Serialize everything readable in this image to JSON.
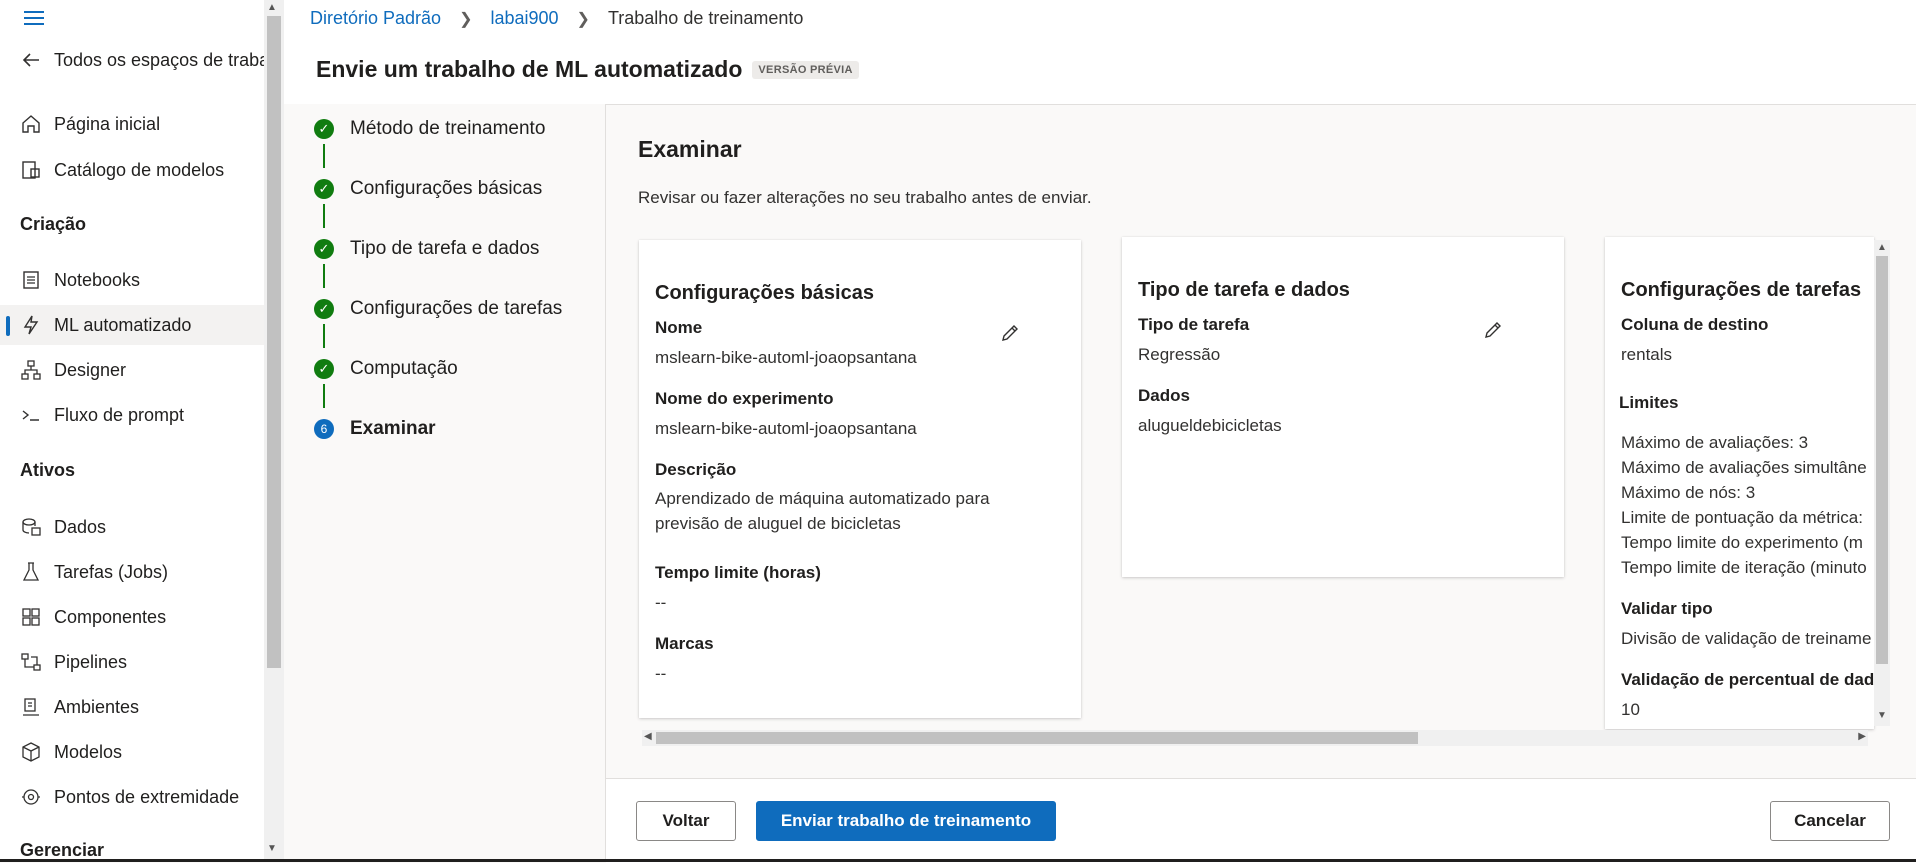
{
  "sidebar": {
    "back_label": "Todos os espaços de trabal",
    "items_top": [
      {
        "label": "Página inicial",
        "icon": "home-icon"
      },
      {
        "label": "Catálogo de modelos",
        "icon": "catalog-icon"
      }
    ],
    "section_authoring": "Criação",
    "items_authoring": [
      {
        "label": "Notebooks",
        "icon": "notebook-icon"
      },
      {
        "label": "ML automatizado",
        "icon": "automl-icon"
      },
      {
        "label": "Designer",
        "icon": "designer-icon"
      },
      {
        "label": "Fluxo de prompt",
        "icon": "prompt-flow-icon"
      }
    ],
    "section_assets": "Ativos",
    "items_assets": [
      {
        "label": "Dados",
        "icon": "data-icon"
      },
      {
        "label": "Tarefas (Jobs)",
        "icon": "jobs-icon"
      },
      {
        "label": "Componentes",
        "icon": "components-icon"
      },
      {
        "label": "Pipelines",
        "icon": "pipelines-icon"
      },
      {
        "label": "Ambientes",
        "icon": "environments-icon"
      },
      {
        "label": "Modelos",
        "icon": "models-icon"
      },
      {
        "label": "Pontos de extremidade",
        "icon": "endpoints-icon"
      }
    ],
    "section_manage": "Gerenciar",
    "active_item": "ML automatizado"
  },
  "breadcrumb": {
    "items": [
      "Diretório Padrão",
      "labai900",
      "Trabalho de treinamento"
    ]
  },
  "header": {
    "title": "Envie um trabalho de ML automatizado",
    "badge": "VERSÃO PRÉVIA"
  },
  "steps": [
    {
      "label": "Método de treinamento",
      "status": "done"
    },
    {
      "label": "Configurações básicas",
      "status": "done"
    },
    {
      "label": "Tipo de tarefa e dados",
      "status": "done"
    },
    {
      "label": "Configurações de tarefas",
      "status": "done"
    },
    {
      "label": "Computação",
      "status": "done"
    },
    {
      "label": "Examinar",
      "status": "current",
      "number": "6"
    }
  ],
  "review": {
    "title": "Examinar",
    "subtitle": "Revisar ou fazer alterações no seu trabalho antes de enviar."
  },
  "card_basic": {
    "title": "Configurações básicas",
    "name_label": "Nome",
    "name_value": "mslearn-bike-automl-joaopsantana",
    "experiment_label": "Nome do experimento",
    "experiment_value": "mslearn-bike-automl-joaopsantana",
    "description_label": "Descrição",
    "description_value": "Aprendizado de máquina automatizado para previsão de aluguel de bicicletas",
    "timeout_label": "Tempo limite (horas)",
    "timeout_value": "--",
    "tags_label": "Marcas",
    "tags_value": "--"
  },
  "card_task": {
    "title": "Tipo de tarefa e dados",
    "task_label": "Tipo de tarefa",
    "task_value": "Regressão",
    "data_label": "Dados",
    "data_value": "alugueldebicicletas"
  },
  "card_settings": {
    "title": "Configurações de tarefas",
    "target_label": "Coluna de destino",
    "target_value": "rentals",
    "limits_label": "Limites",
    "limits": [
      "Máximo de avaliações: 3",
      "Máximo de avaliações simultâne",
      "Máximo de nós: 3",
      "Limite de pontuação da métrica:",
      "Tempo limite do experimento (m",
      "Tempo limite de iteração (minuto"
    ],
    "validation_label": "Validar tipo",
    "validation_value": "Divisão de validação de treiname",
    "percent_label": "Validação de percentual de dad",
    "percent_value": "10"
  },
  "footer": {
    "back_label": "Voltar",
    "submit_label": "Enviar trabalho de treinamento",
    "cancel_label": "Cancelar"
  },
  "colors": {
    "accent": "#0f6cbd",
    "success": "#107c10"
  }
}
